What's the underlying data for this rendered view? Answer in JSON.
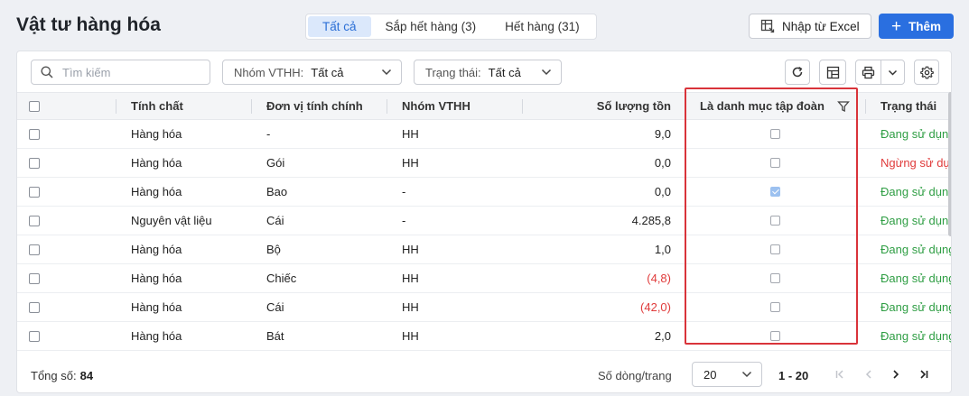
{
  "page_title": "Vật tư hàng hóa",
  "tabs": [
    {
      "label": "Tất cả",
      "active": true
    },
    {
      "label": "Sắp hết hàng (3)",
      "active": false
    },
    {
      "label": "Hết hàng (31)",
      "active": false
    }
  ],
  "actions": {
    "import_label": "Nhập từ Excel",
    "add_label": "Thêm"
  },
  "filters": {
    "search_placeholder": "Tìm kiếm",
    "group_label": "Nhóm VTHH:",
    "group_value": "Tất cả",
    "status_label": "Trạng thái:",
    "status_value": "Tất cả"
  },
  "columns": [
    "Tính chất",
    "Đơn vị tính chính",
    "Nhóm VTHH",
    "Số lượng tồn",
    "Là danh mục tập đoàn",
    "Trạng thái"
  ],
  "rows": [
    {
      "nature": "Hàng hóa",
      "unit": "-",
      "group": "HH",
      "qty": "9,0",
      "negative": false,
      "corporate": false,
      "status": "Đang sử dụng",
      "status_active": true
    },
    {
      "nature": "Hàng hóa",
      "unit": "Gói",
      "group": "HH",
      "qty": "0,0",
      "negative": false,
      "corporate": false,
      "status": "Ngừng sử dụng",
      "status_active": false
    },
    {
      "nature": "Hàng hóa",
      "unit": "Bao",
      "group": "-",
      "qty": "0,0",
      "negative": false,
      "corporate": true,
      "status": "Đang sử dụng",
      "status_active": true
    },
    {
      "nature": "Nguyên vật liệu",
      "unit": "Cái",
      "group": "-",
      "qty": "4.285,8",
      "negative": false,
      "corporate": false,
      "status": "Đang sử dụng",
      "status_active": true
    },
    {
      "nature": "Hàng hóa",
      "unit": "Bộ",
      "group": "HH",
      "qty": "1,0",
      "negative": false,
      "corporate": false,
      "status": "Đang sử dụng",
      "status_active": true
    },
    {
      "nature": "Hàng hóa",
      "unit": "Chiếc",
      "group": "HH",
      "qty": "(4,8)",
      "negative": true,
      "corporate": false,
      "status": "Đang sử dụng",
      "status_active": true
    },
    {
      "nature": "Hàng hóa",
      "unit": "Cái",
      "group": "HH",
      "qty": "(42,0)",
      "negative": true,
      "corporate": false,
      "status": "Đang sử dụng",
      "status_active": true
    },
    {
      "nature": "Hàng hóa",
      "unit": "Bát",
      "group": "HH",
      "qty": "2,0",
      "negative": false,
      "corporate": false,
      "status": "Đang sử dụng",
      "status_active": true
    }
  ],
  "footer": {
    "total_label": "Tổng số:",
    "total_value": "84",
    "rows_per_page_label": "Số dòng/trang",
    "rows_per_page_value": "20",
    "range": "1 - 20"
  },
  "colors": {
    "accent": "#2a6fe0",
    "active_status": "#2f9e44",
    "inactive_status": "#e03b3b",
    "highlight": "#d9333a"
  }
}
